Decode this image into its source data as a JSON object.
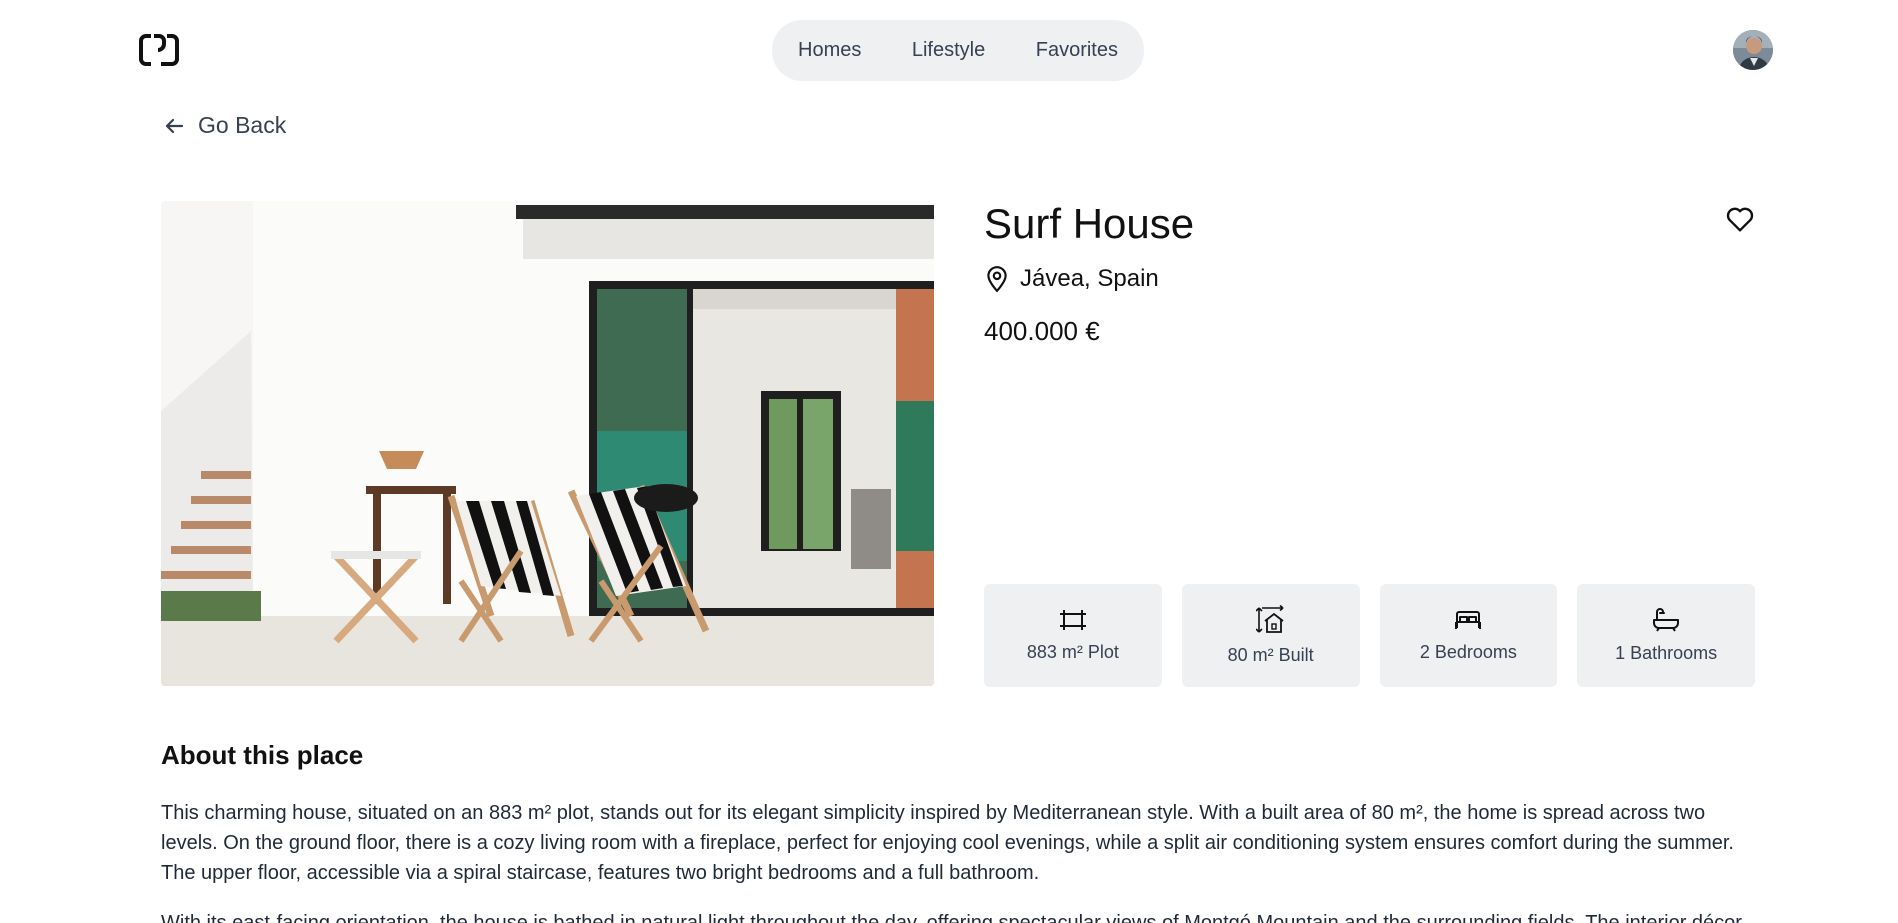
{
  "header": {
    "nav": [
      "Homes",
      "Lifestyle",
      "Favorites"
    ]
  },
  "go_back": {
    "label": "Go Back"
  },
  "listing": {
    "title": "Surf House",
    "location": "Jávea, Spain",
    "price": "400.000 €",
    "features": [
      {
        "icon": "plot-frame-icon",
        "label": "883 m² Plot"
      },
      {
        "icon": "built-house-icon",
        "label": "80 m² Built"
      },
      {
        "icon": "bed-icon",
        "label": "2 Bedrooms"
      },
      {
        "icon": "bathtub-icon",
        "label": "1 Bathrooms"
      }
    ]
  },
  "about": {
    "heading": "About this place",
    "paragraphs": [
      "This charming house, situated on an 883 m² plot, stands out for its elegant simplicity inspired by Mediterranean style. With a built area of 80 m², the home is spread across two levels. On the ground floor, there is a cozy living room with a fireplace, perfect for enjoying cool evenings, while a split air conditioning system ensures comfort during the summer. The upper floor, accessible via a spiral staircase, features two bright bedrooms and a full bathroom.",
      "With its east-facing orientation, the house is bathed in natural light throughout the day, offering spectacular views of Montgó Mountain and the surrounding fields. The interior décor"
    ]
  },
  "colors": {
    "nav_bg": "#eef0f2",
    "card_bg": "#eef0f2",
    "text_primary": "#111111",
    "text_secondary": "#374151"
  }
}
